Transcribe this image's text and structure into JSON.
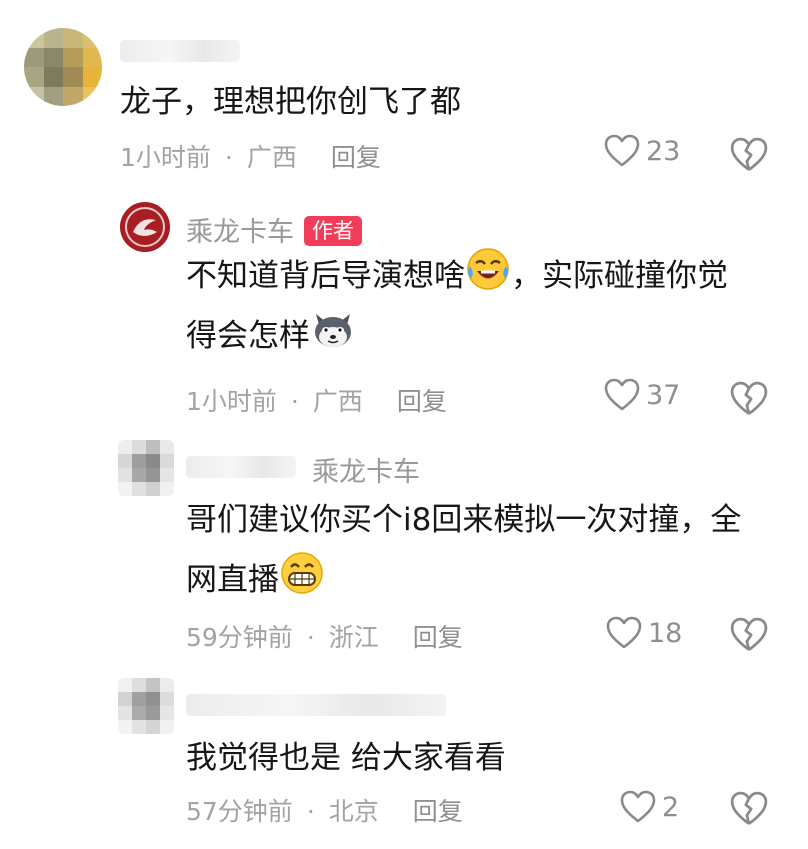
{
  "colors": {
    "badge": "#f23d5a",
    "meta": "#a3a3a3",
    "text": "#161616"
  },
  "comments": [
    {
      "text": "龙子，理想把你创飞了都",
      "time": "1小时前",
      "sep": "·",
      "location": "广西",
      "reply": "回复",
      "likes": "23"
    },
    {
      "name": "乘龙卡车",
      "badge": "作者",
      "text1": "不知道背后导演想啥",
      "text2": "，实际碰撞你觉",
      "text3": "得会怎样",
      "time": "1小时前",
      "sep": "·",
      "location": "广西",
      "reply": "回复",
      "likes": "37"
    },
    {
      "reply_to": "乘龙卡车",
      "text1": "哥们建议你买个i8回来模拟一次对撞，全",
      "text2": "网直播",
      "time": "59分钟前",
      "sep": "·",
      "location": "浙江",
      "reply": "回复",
      "likes": "18"
    },
    {
      "text": "我觉得也是 给大家看看",
      "time": "57分钟前",
      "sep": "·",
      "location": "北京",
      "reply": "回复",
      "likes": "2"
    }
  ]
}
